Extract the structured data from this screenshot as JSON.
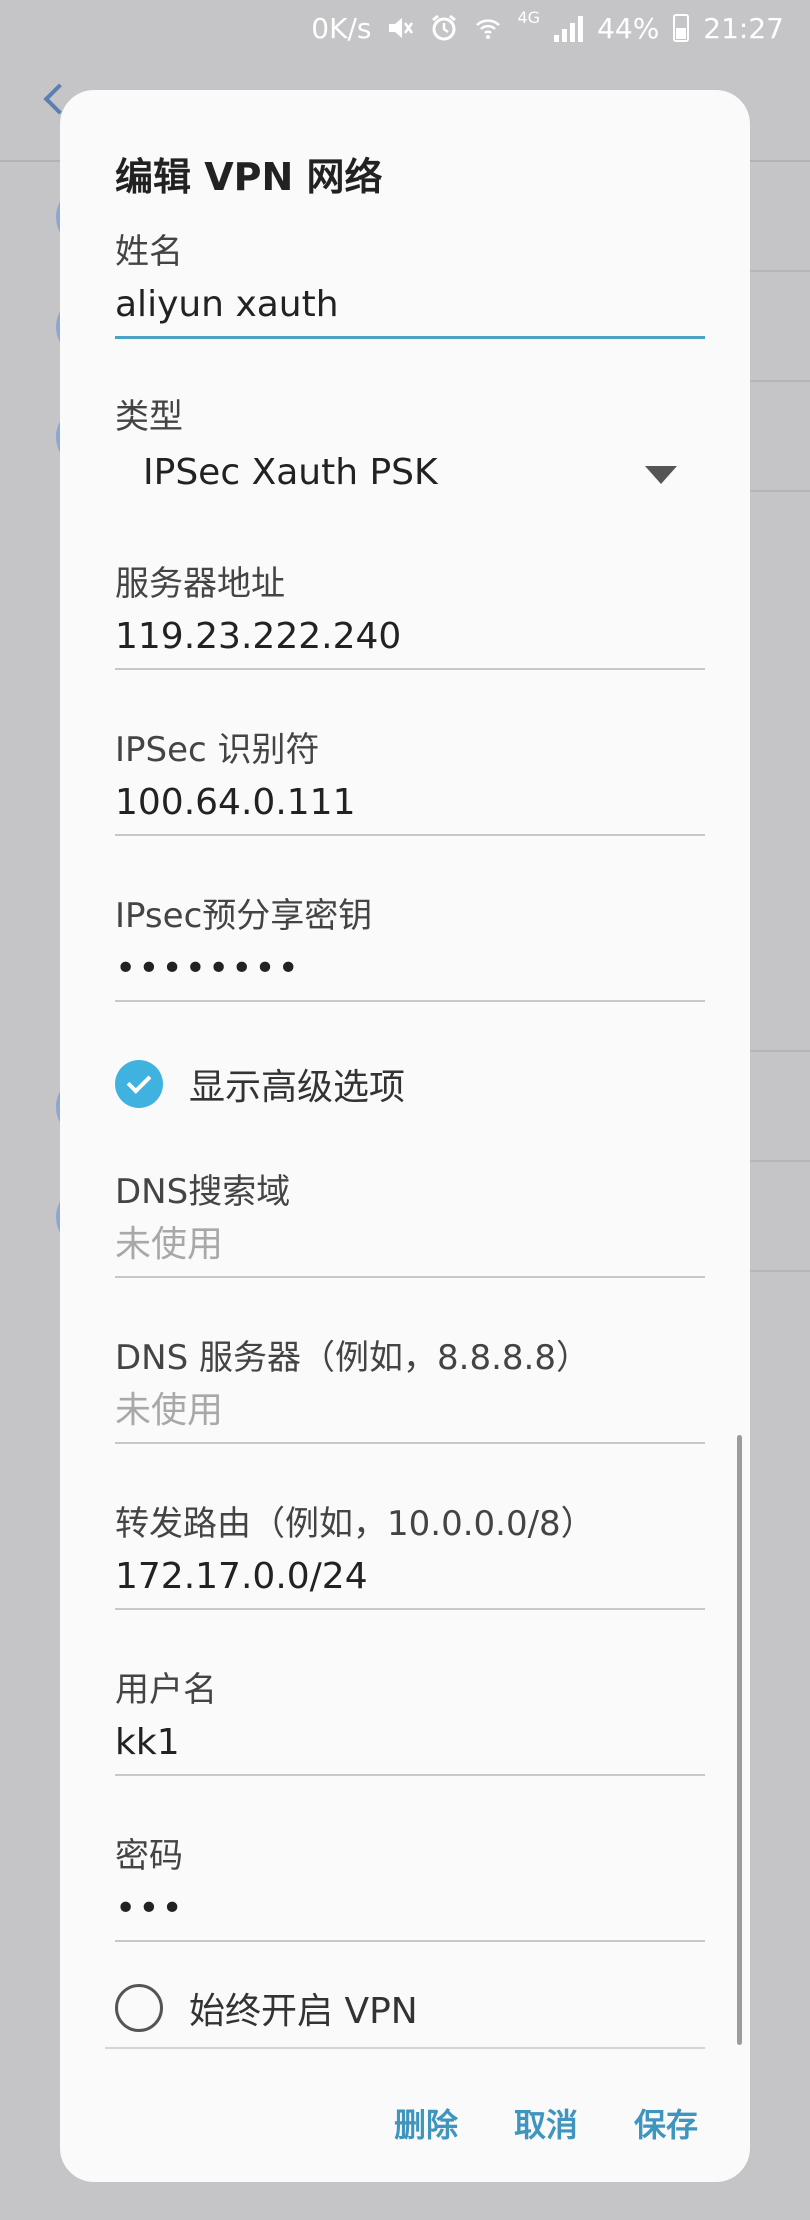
{
  "status_bar": {
    "net_speed": "0K/s",
    "network_type": "4G",
    "battery": "44%",
    "time": "21:27",
    "icons": [
      "mute-icon",
      "alarm-icon",
      "wifi-icon",
      "signal-icon",
      "battery-icon"
    ]
  },
  "dialog": {
    "title": "编辑 VPN 网络",
    "fields": {
      "name": {
        "label": "姓名",
        "value": "aliyun xauth"
      },
      "type": {
        "label": "类型",
        "value": "IPSec Xauth PSK"
      },
      "server": {
        "label": "服务器地址",
        "value": "119.23.222.240"
      },
      "ipsec_id": {
        "label": "IPSec 识别符",
        "value": "100.64.0.111"
      },
      "psk": {
        "label": "IPsec预分享密钥",
        "value": "••••••••"
      },
      "dns_search": {
        "label": "DNS搜索域",
        "placeholder": "未使用"
      },
      "dns_server": {
        "label": "DNS 服务器（例如，8.8.8.8）",
        "placeholder": "未使用"
      },
      "routes": {
        "label": "转发路由（例如，10.0.0.0/8）",
        "value": "172.17.0.0/24"
      },
      "username": {
        "label": "用户名",
        "value": "kk1"
      },
      "password": {
        "label": "密码",
        "value": "•••"
      }
    },
    "show_advanced": {
      "label": "显示高级选项",
      "checked": true
    },
    "always_on": {
      "label": "始终开启 VPN",
      "checked": false
    },
    "actions": {
      "delete": "删除",
      "cancel": "取消",
      "save": "保存"
    },
    "accent_color": "#3fb2e0",
    "button_color": "#3f95be"
  }
}
